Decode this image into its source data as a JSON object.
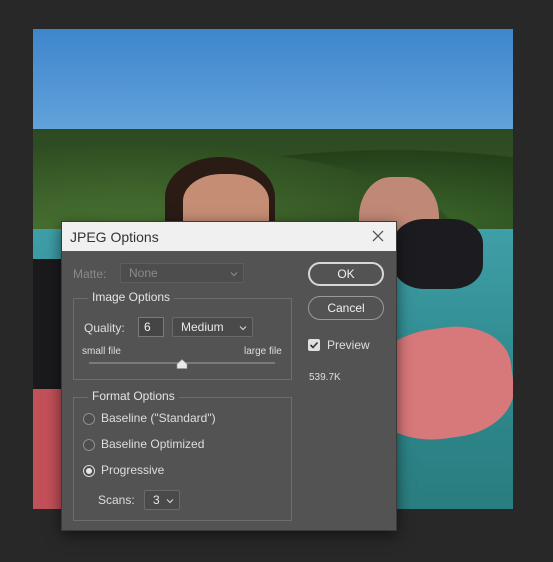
{
  "dialog": {
    "title": "JPEG Options",
    "matte": {
      "label": "Matte:",
      "value": "None"
    },
    "image_options": {
      "title": "Image Options",
      "quality_label": "Quality:",
      "quality_value": "6",
      "quality_preset": "Medium",
      "small_label": "small file",
      "large_label": "large file",
      "slider_fraction": 0.5
    },
    "format_options": {
      "title": "Format Options",
      "options": [
        {
          "label": "Baseline (\"Standard\")",
          "selected": false
        },
        {
          "label": "Baseline Optimized",
          "selected": false
        },
        {
          "label": "Progressive",
          "selected": true
        }
      ],
      "scans_label": "Scans:",
      "scans_value": "3"
    },
    "ok_label": "OK",
    "cancel_label": "Cancel",
    "preview_label": "Preview",
    "preview_checked": true,
    "file_size": "539.7K"
  },
  "icons": {
    "close": "close-icon",
    "chevron": "chevron-down-icon",
    "check": "checkmark-icon",
    "slider": "slider-thumb-icon"
  }
}
